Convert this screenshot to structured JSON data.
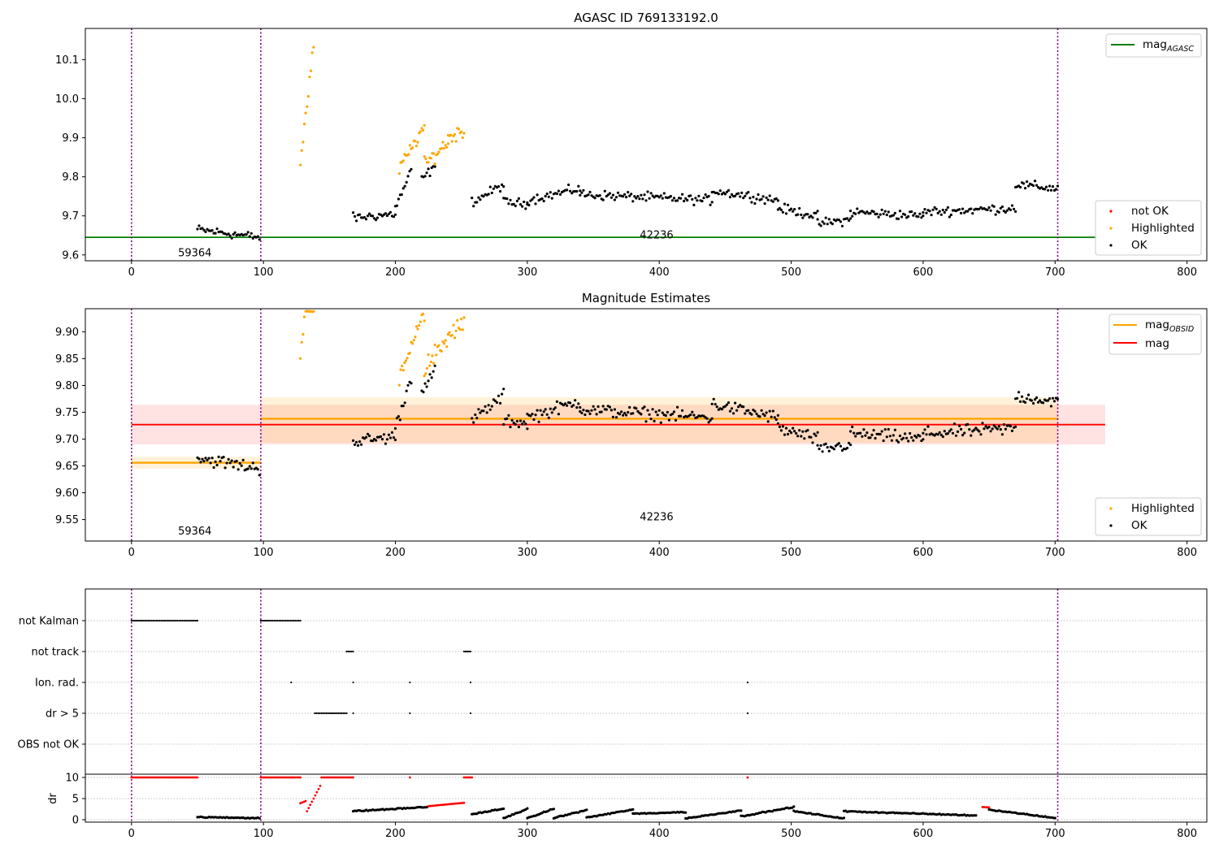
{
  "figure": {
    "panel1_title": "AGASC ID 769133192.0",
    "panel2_title": "Magnitude Estimates",
    "obsid_labels": [
      "59364",
      "42236"
    ],
    "ylabel_dr": "dr",
    "colors": {
      "ok": "#000000",
      "highlighted": "#ffa500",
      "not_ok": "#ff0000",
      "mag_agasc": "#008000",
      "mag": "#ff0000",
      "mag_obsid": "#ffa500",
      "vline": "#800080"
    }
  },
  "chart_data": [
    {
      "type": "scatter",
      "title": "AGASC ID 769133192.0",
      "xlim": [
        -35,
        815
      ],
      "ylim": [
        9.585,
        10.18
      ],
      "xticks": [
        0,
        100,
        200,
        300,
        400,
        500,
        600,
        700,
        800
      ],
      "yticks": [
        9.6,
        9.7,
        9.8,
        9.9,
        10.0,
        10.1
      ],
      "vlines_x": [
        0,
        98,
        702
      ],
      "mag_agasc": 9.645,
      "legend_top": [
        "magAGASC"
      ],
      "legend_bottom": [
        "not OK",
        "Highlighted",
        "OK"
      ],
      "annotations": [
        {
          "text": "59364",
          "x": 48,
          "y": 9.605
        },
        {
          "text": "42236",
          "x": 398,
          "y": 9.644
        }
      ],
      "series": [
        {
          "name": "OK",
          "segments": [
            {
              "x": [
                50,
                97
              ],
              "y": [
                9.665,
                9.645
              ]
            },
            {
              "x": [
                168,
                200
              ],
              "y": [
                9.695,
                9.705
              ]
            },
            {
              "x": [
                200,
                212
              ],
              "y": [
                9.72,
                9.815
              ]
            },
            {
              "x": [
                220,
                230
              ],
              "y": [
                9.795,
                9.825
              ]
            },
            {
              "x": [
                258,
                282
              ],
              "y": [
                9.735,
                9.78
              ]
            },
            {
              "x": [
                282,
                300
              ],
              "y": [
                9.735,
                9.73
              ]
            },
            {
              "x": [
                300,
                340
              ],
              "y": [
                9.74,
                9.77
              ]
            },
            {
              "x": [
                340,
                440
              ],
              "y": [
                9.755,
                9.74
              ]
            },
            {
              "x": [
                440,
                490
              ],
              "y": [
                9.765,
                9.74
              ]
            },
            {
              "x": [
                490,
                520
              ],
              "y": [
                9.72,
                9.7
              ]
            },
            {
              "x": [
                520,
                545
              ],
              "y": [
                9.68,
                9.69
              ]
            },
            {
              "x": [
                545,
                600
              ],
              "y": [
                9.71,
                9.7
              ]
            },
            {
              "x": [
                600,
                670
              ],
              "y": [
                9.71,
                9.72
              ]
            },
            {
              "x": [
                670,
                702
              ],
              "y": [
                9.78,
                9.77
              ]
            }
          ]
        },
        {
          "name": "Highlighted",
          "segments": [
            {
              "x": [
                128,
                138
              ],
              "y": [
                9.84,
                10.13
              ]
            },
            {
              "x": [
                203,
                222
              ],
              "y": [
                9.82,
                9.93
              ]
            },
            {
              "x": [
                222,
                240
              ],
              "y": [
                9.83,
                9.89
              ]
            },
            {
              "x": [
                240,
                252
              ],
              "y": [
                9.9,
                9.92
              ]
            }
          ]
        }
      ]
    },
    {
      "type": "scatter",
      "title": "Magnitude Estimates",
      "xlim": [
        -35,
        815
      ],
      "ylim": [
        9.51,
        9.943
      ],
      "xticks": [
        0,
        100,
        200,
        300,
        400,
        500,
        600,
        700,
        800
      ],
      "yticks": [
        9.55,
        9.6,
        9.65,
        9.7,
        9.75,
        9.8,
        9.85,
        9.9
      ],
      "vlines_x": [
        0,
        98,
        702
      ],
      "mag": {
        "value": 9.727,
        "x": [
          0,
          738
        ],
        "band": [
          9.69,
          9.764
        ]
      },
      "mag_obsid": [
        {
          "x": [
            0,
            98
          ],
          "value": 9.656,
          "band": [
            9.645,
            9.667
          ]
        },
        {
          "x": [
            98,
            702
          ],
          "value": 9.738,
          "band": [
            9.693,
            9.778
          ]
        }
      ],
      "legend_top": [
        "magOBSID",
        "mag"
      ],
      "legend_bottom": [
        "Highlighted",
        "OK"
      ],
      "annotations": [
        {
          "text": "59364",
          "x": 48,
          "y": 9.528
        },
        {
          "text": "42236",
          "x": 398,
          "y": 9.555
        }
      ]
    },
    {
      "type": "scatter",
      "title": "",
      "xlim": [
        -35,
        815
      ],
      "xticks": [
        0,
        100,
        200,
        300,
        400,
        500,
        600,
        700,
        800
      ],
      "vlines_x": [
        0,
        98,
        702
      ],
      "flag_rows": [
        "not Kalman",
        "not track",
        "Ion. rad.",
        "dr > 5",
        "OBS not OK"
      ],
      "flags": {
        "not Kalman": [
          [
            0,
            50
          ],
          [
            98,
            128
          ]
        ],
        "not track": [
          [
            163,
            168
          ],
          [
            252,
            257
          ]
        ],
        "Ion. rad.": [
          [
            121,
            121
          ],
          [
            168,
            168
          ],
          [
            211,
            211
          ],
          [
            257,
            257
          ],
          [
            467,
            467
          ]
        ],
        "dr > 5": [
          [
            139,
            163
          ],
          [
            168,
            168
          ],
          [
            211,
            211
          ],
          [
            257,
            257
          ],
          [
            467,
            467
          ]
        ]
      },
      "dr": {
        "ylabel": "dr",
        "ylim": [
          0,
          10
        ],
        "yticks": [
          0,
          5,
          10
        ],
        "red_segments": [
          {
            "x": [
              0,
              50
            ],
            "y": [
              10,
              10
            ]
          },
          {
            "x": [
              98,
              128
            ],
            "y": [
              10,
              10
            ]
          },
          {
            "x": [
              128,
              132
            ],
            "y": [
              3.9,
              4.4
            ]
          },
          {
            "x": [
              133,
              143
            ],
            "y": [
              2.0,
              8.0
            ]
          },
          {
            "x": [
              144,
              168
            ],
            "y": [
              10,
              10
            ]
          },
          {
            "x": [
              211,
              211
            ],
            "y": [
              10,
              10
            ]
          },
          {
            "x": [
              225,
              252
            ],
            "y": [
              3.2,
              4.0
            ]
          },
          {
            "x": [
              252,
              258
            ],
            "y": [
              10,
              10
            ]
          },
          {
            "x": [
              467,
              467
            ],
            "y": [
              10,
              10
            ]
          },
          {
            "x": [
              645,
              650
            ],
            "y": [
              3.0,
              2.9
            ]
          }
        ],
        "black_segments": [
          {
            "x": [
              50,
              97
            ],
            "y": [
              0.6,
              0.4
            ]
          },
          {
            "x": [
              168,
              224
            ],
            "y": [
              2.0,
              3.0
            ]
          },
          {
            "x": [
              258,
              282
            ],
            "y": [
              1.3,
              2.6
            ]
          },
          {
            "x": [
              282,
              300
            ],
            "y": [
              0.3,
              2.6
            ]
          },
          {
            "x": [
              300,
              320
            ],
            "y": [
              0.3,
              2.6
            ]
          },
          {
            "x": [
              320,
              345
            ],
            "y": [
              0.4,
              2.3
            ]
          },
          {
            "x": [
              345,
              380
            ],
            "y": [
              0.5,
              2.4
            ]
          },
          {
            "x": [
              380,
              420
            ],
            "y": [
              1.4,
              1.8
            ]
          },
          {
            "x": [
              420,
              462
            ],
            "y": [
              0.3,
              2.2
            ]
          },
          {
            "x": [
              462,
              502
            ],
            "y": [
              0.8,
              3.0
            ]
          },
          {
            "x": [
              502,
              540
            ],
            "y": [
              2.0,
              0.3
            ]
          },
          {
            "x": [
              540,
              640
            ],
            "y": [
              2.0,
              1.0
            ]
          },
          {
            "x": [
              650,
              700
            ],
            "y": [
              2.4,
              0.4
            ]
          }
        ]
      }
    }
  ]
}
